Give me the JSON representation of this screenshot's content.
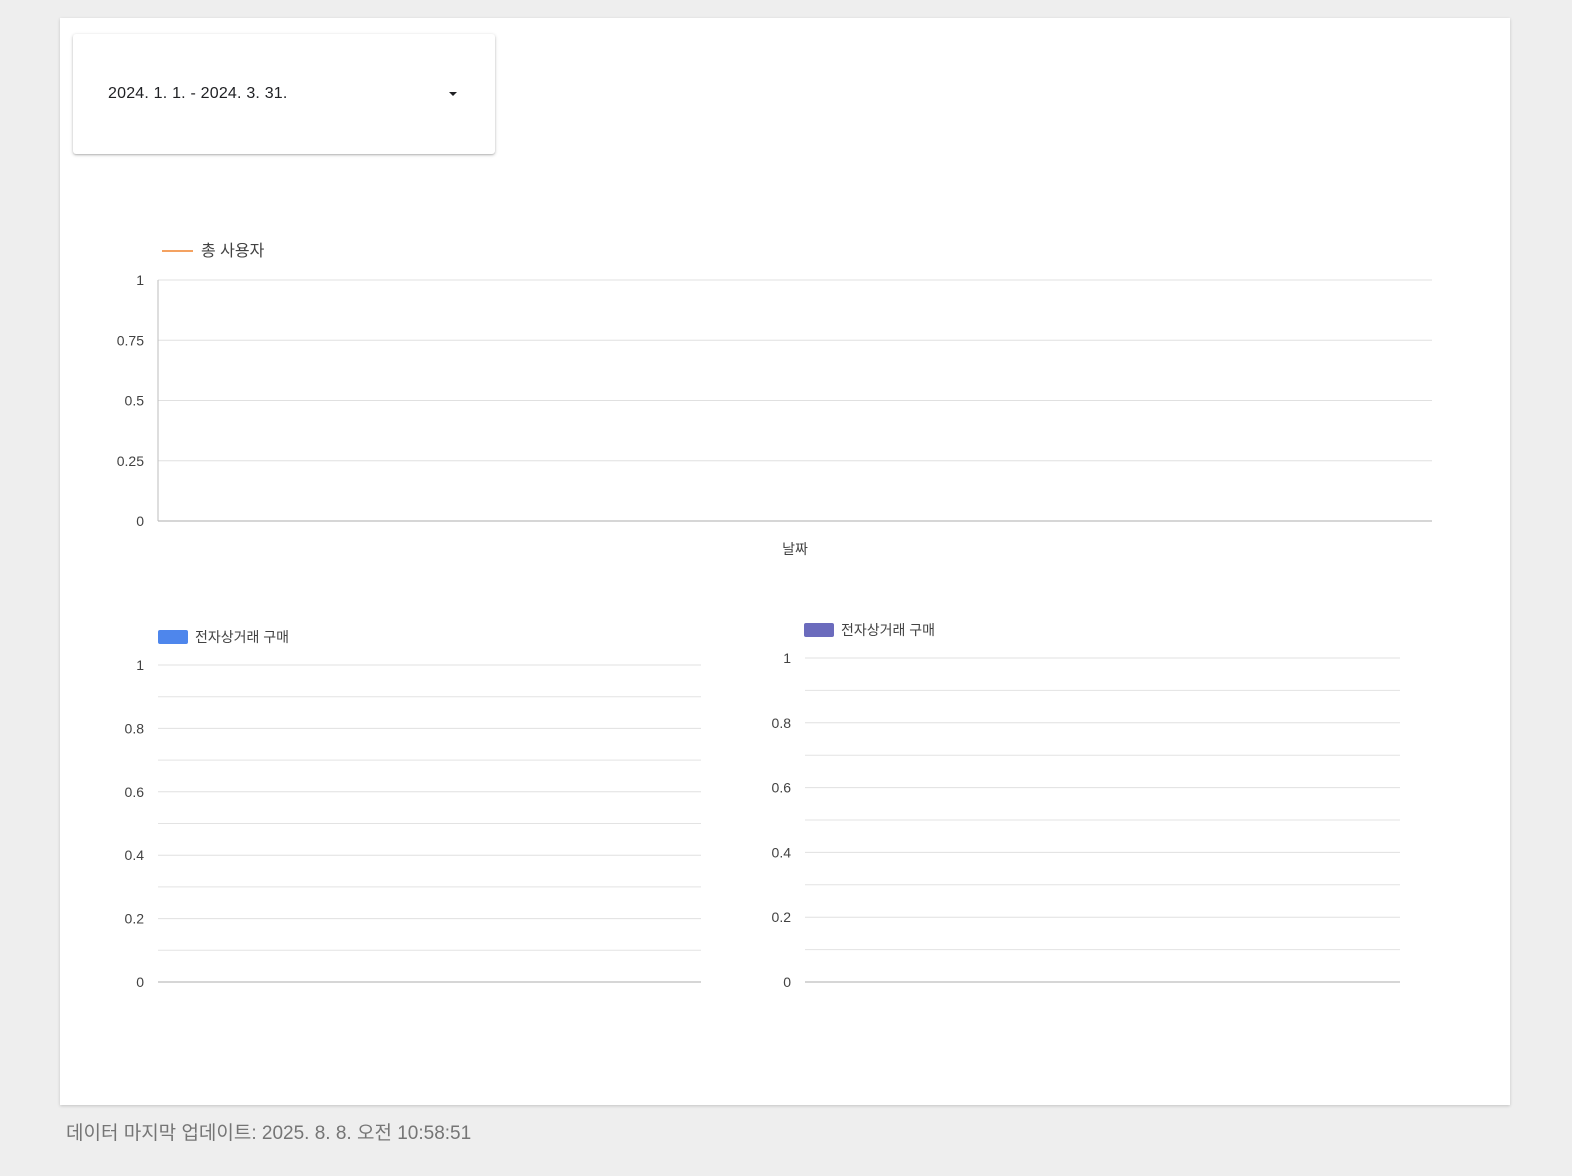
{
  "date_range": {
    "label": "2024. 1. 1. - 2024. 3. 31.",
    "dropdown_icon": "caret-down-icon"
  },
  "chart_data": [
    {
      "type": "line",
      "legend": [
        "총 사용자"
      ],
      "series": [
        {
          "name": "총 사용자",
          "color": "#f4a261",
          "values": []
        }
      ],
      "xlabel": "날짜",
      "ylabel": "",
      "ylim": [
        0,
        1
      ],
      "yticks": [
        "0",
        "0.25",
        "0.5",
        "0.75",
        "1"
      ],
      "grid": true,
      "legend_placement": "top-left"
    },
    {
      "type": "bar",
      "legend": [
        "전자상거래 구매"
      ],
      "series": [
        {
          "name": "전자상거래 구매",
          "color": "#4e86ec",
          "values": []
        }
      ],
      "xlabel": "",
      "ylabel": "",
      "ylim": [
        0,
        1
      ],
      "yticks": [
        "0",
        "0.2",
        "0.4",
        "0.6",
        "0.8",
        "1"
      ],
      "grid": true,
      "legend_placement": "top-left"
    },
    {
      "type": "bar",
      "legend": [
        "전자상거래 구매"
      ],
      "series": [
        {
          "name": "전자상거래 구매",
          "color": "#6b6bbd",
          "values": []
        }
      ],
      "xlabel": "",
      "ylabel": "",
      "ylim": [
        0,
        1
      ],
      "yticks": [
        "0",
        "0.2",
        "0.4",
        "0.6",
        "0.8",
        "1"
      ],
      "grid": true,
      "legend_placement": "top-left"
    }
  ],
  "footer": {
    "last_updated": "데이터 마지막 업데이트: 2025. 8. 8. 오전 10:58:51"
  }
}
